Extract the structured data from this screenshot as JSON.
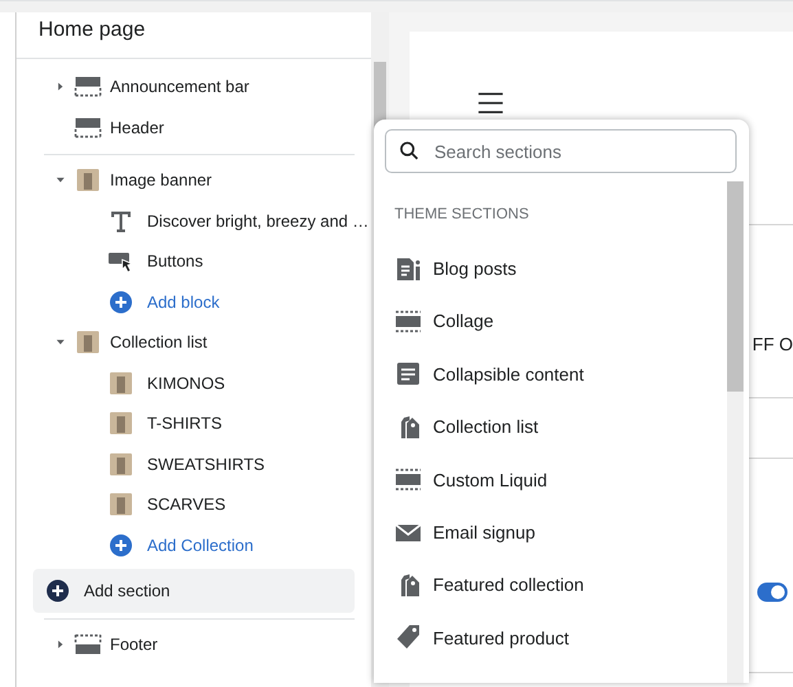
{
  "sidebar": {
    "title": "Home page",
    "sections": [
      {
        "label": "Announcement bar",
        "kind": "bar-top",
        "expanded": false
      },
      {
        "label": "Header",
        "kind": "bar-top",
        "divider_after": true
      },
      {
        "label": "Image banner",
        "kind": "photo",
        "expanded": true,
        "children": [
          {
            "label": "Discover bright, breezy and …",
            "kind": "text"
          },
          {
            "label": "Buttons",
            "kind": "buttons"
          },
          {
            "label": "Add block",
            "kind": "add"
          }
        ]
      },
      {
        "label": "Collection list",
        "kind": "photo",
        "expanded": true,
        "children": [
          {
            "label": "KIMONOS",
            "kind": "photo"
          },
          {
            "label": "T-SHIRTS",
            "kind": "photo"
          },
          {
            "label": "SWEATSHIRTS",
            "kind": "photo"
          },
          {
            "label": "SCARVES",
            "kind": "photo"
          },
          {
            "label": "Add Collection",
            "kind": "add"
          }
        ]
      },
      {
        "label": "Add section",
        "kind": "add-section",
        "divider_after": true
      },
      {
        "label": "Footer",
        "kind": "bar-bottom",
        "expanded": false
      }
    ]
  },
  "preview": {
    "text": "FF O",
    "toggle": {
      "on": true
    }
  },
  "picker": {
    "search": {
      "placeholder": "Search sections"
    },
    "heading": "THEME SECTIONS",
    "items": [
      {
        "label": "Blog posts",
        "kind": "blog"
      },
      {
        "label": "Collage",
        "kind": "bar-both"
      },
      {
        "label": "Collapsible content",
        "kind": "collapsible"
      },
      {
        "label": "Collection list",
        "kind": "tags"
      },
      {
        "label": "Custom Liquid",
        "kind": "bar-both"
      },
      {
        "label": "Email signup",
        "kind": "email"
      },
      {
        "label": "Featured collection",
        "kind": "tags"
      },
      {
        "label": "Featured product",
        "kind": "tag"
      }
    ]
  }
}
